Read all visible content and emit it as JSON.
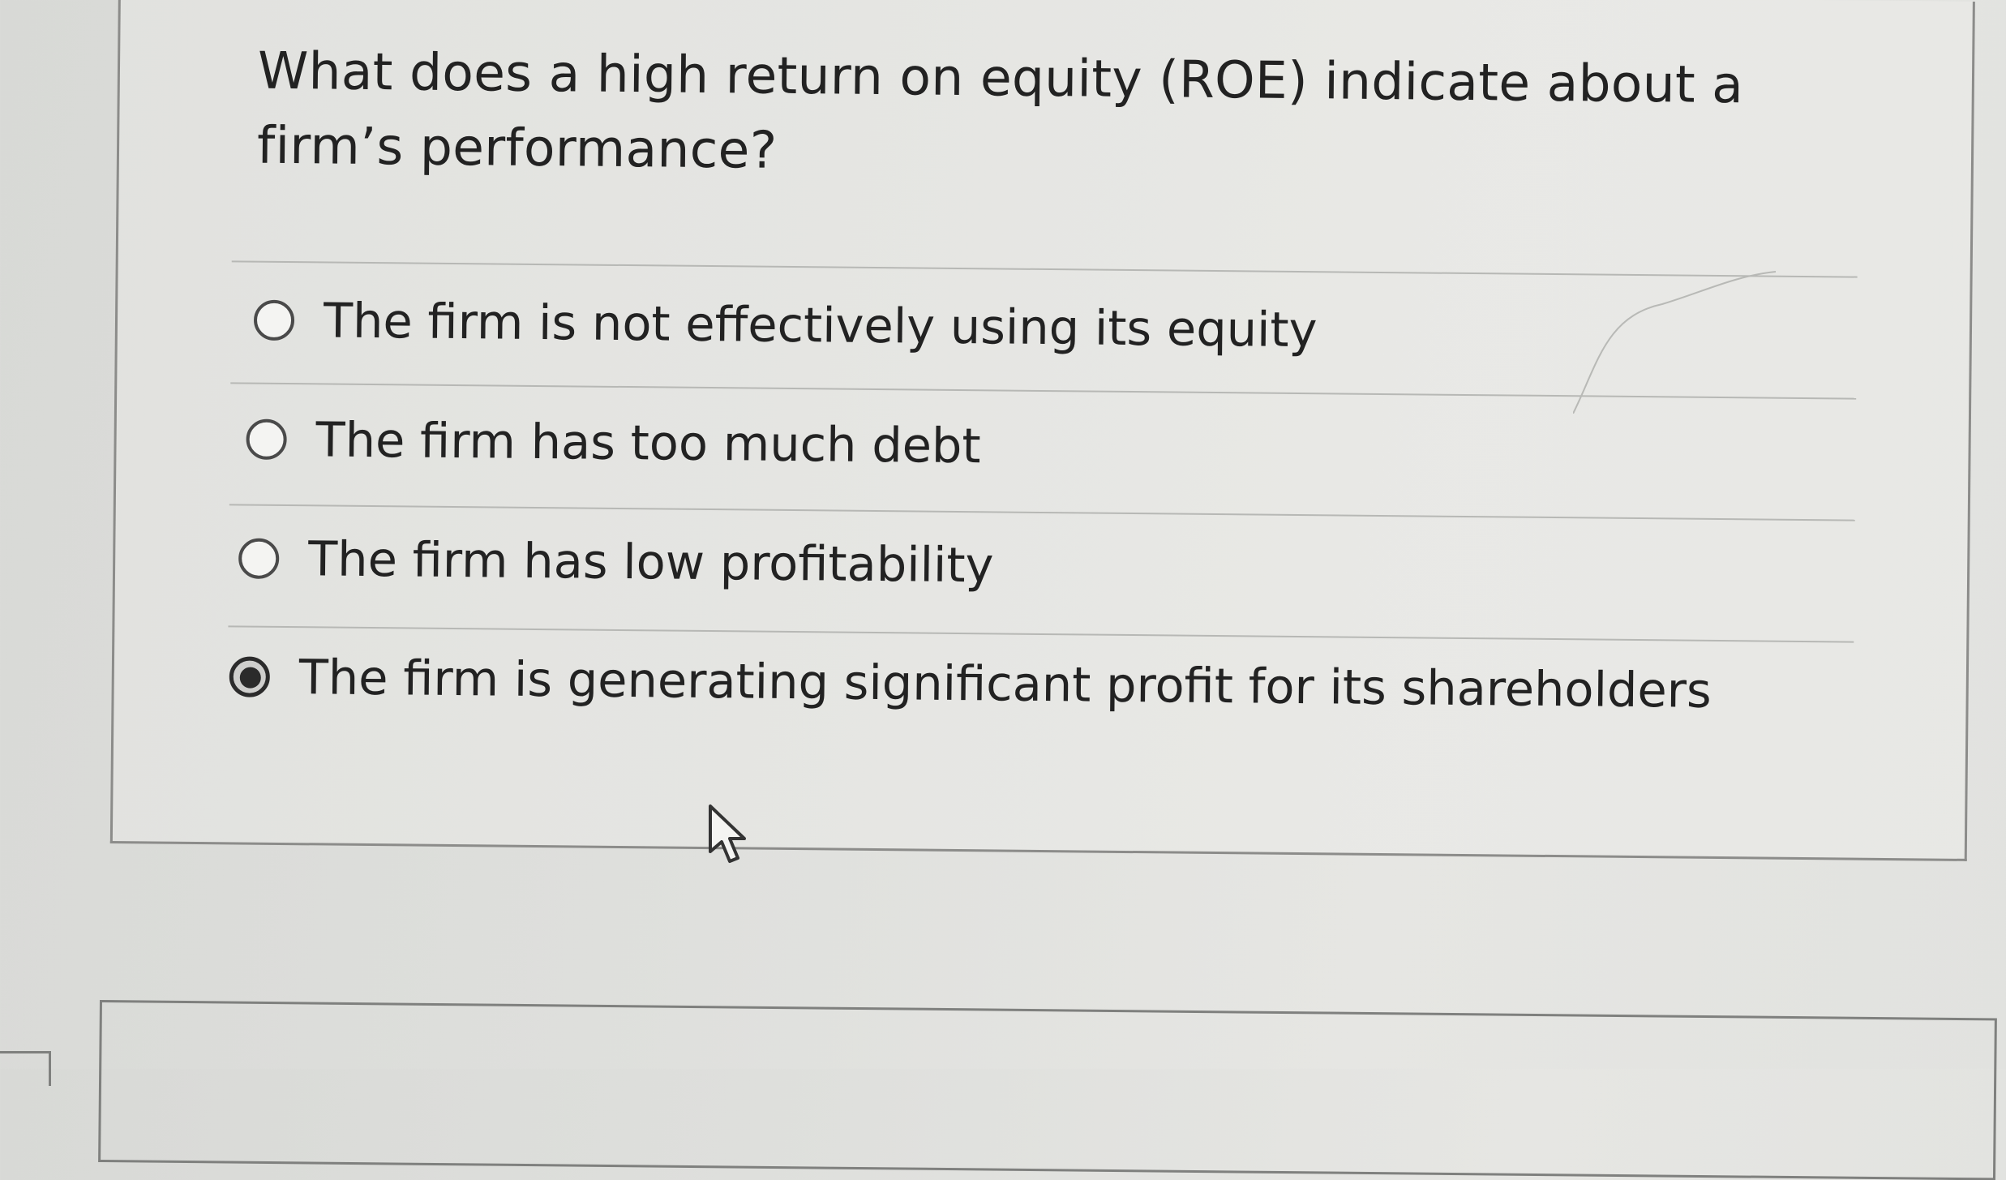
{
  "question": {
    "text": "What does a high return on equity (ROE) indicate about a firm’s performance?"
  },
  "options": [
    {
      "label": "The firm is not effectively using its equity",
      "selected": false
    },
    {
      "label": "The firm has too much debt",
      "selected": false
    },
    {
      "label": "The firm has low profitability",
      "selected": false
    },
    {
      "label": "The firm is generating significant profit for its shareholders",
      "selected": true
    }
  ],
  "colors": {
    "border": "#8c8c8a",
    "text": "#222222",
    "divider": "#b7b8b5"
  },
  "icons": {
    "cursor": "pointer-cursor-icon"
  }
}
